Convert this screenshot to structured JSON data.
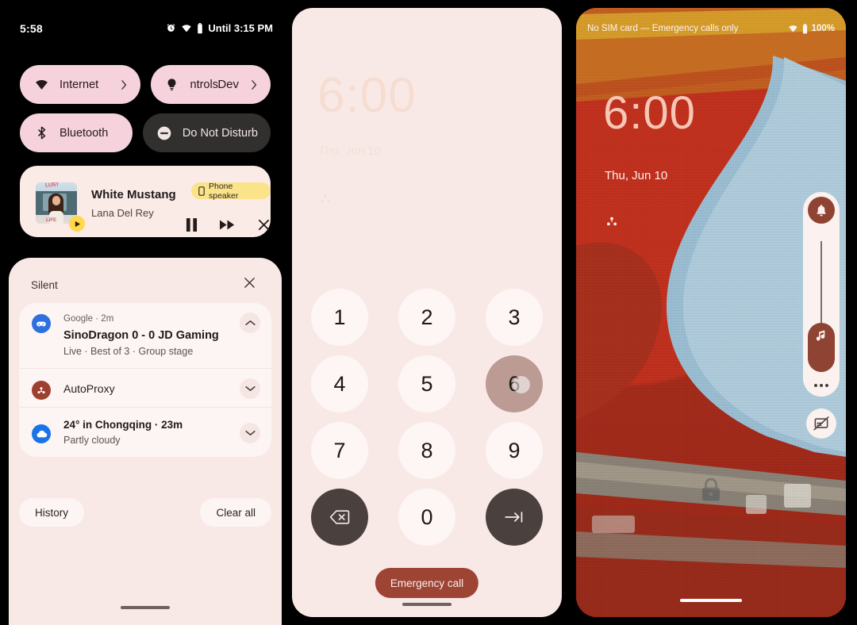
{
  "quick_settings": {
    "status_bar": {
      "time": "5:58",
      "alarm_icon": "alarm-icon",
      "wifi_icon": "wifi-icon",
      "battery_icon": "battery-icon",
      "dnd_until": "Until 3:15 PM"
    },
    "tiles": [
      {
        "label": "Internet",
        "icon": "wifi-icon",
        "state": "on",
        "has_chevron": true
      },
      {
        "label": "ntrols",
        "label_secondary": "Dev",
        "icon": "lightbulb-icon",
        "state": "on",
        "has_chevron": true
      },
      {
        "label": "Bluetooth",
        "icon": "bluetooth-icon",
        "state": "on",
        "has_chevron": false
      },
      {
        "label": "Do Not Disturb",
        "icon": "dnd-icon",
        "state": "off",
        "has_chevron": false
      }
    ],
    "media_player": {
      "title": "White Mustang",
      "artist": "Lana Del Rey",
      "output_chip": "Phone speaker",
      "output_icon": "phone-icon",
      "album_top_text": "LUST",
      "album_bottom_text": "LIFE",
      "pause_icon": "pause-icon",
      "next_icon": "fast-forward-icon",
      "close_icon": "close-icon",
      "play_badge_icon": "play-icon"
    },
    "shade": {
      "section_title": "Silent",
      "close_icon": "close-icon",
      "notifications": [
        {
          "app": "Google",
          "time": "2m",
          "meta": "Google · 2m",
          "title": "SinoDragon 0 - 0 JD Gaming",
          "subtitle": "Live · Best of 3 · Group stage",
          "icon": "gamepad-icon",
          "icon_color": "#2f6fe0",
          "expand_icon": "chevron-up-icon"
        },
        {
          "app": "AutoProxy",
          "meta": "AutoProxy",
          "icon": "autoproxy-icon",
          "icon_color": "#9e4030",
          "expand_icon": "chevron-down-icon"
        },
        {
          "app": "Weather",
          "meta": "24° in Chongqing · 23m",
          "title_line": "24° in Chongqing",
          "time": "23m",
          "subtitle": "Partly cloudy",
          "icon": "cloud-icon",
          "icon_color": "#1a73e8",
          "expand_icon": "chevron-down-icon"
        }
      ],
      "history_label": "History",
      "clear_all_label": "Clear all"
    }
  },
  "dialer": {
    "ghost_clock": "6:00",
    "ghost_date": "Thu, Jun 10",
    "ghost_icon": "autoproxy-icon",
    "keys": [
      [
        "1",
        "2",
        "3"
      ],
      [
        "4",
        "5",
        "6"
      ],
      [
        "7",
        "8",
        "9"
      ]
    ],
    "pressed_key": "6",
    "bottom_row": {
      "backspace_icon": "backspace-icon",
      "zero": "0",
      "next_icon": "tab-next-icon"
    },
    "emergency_call_label": "Emergency call"
  },
  "lock_screen": {
    "status_bar": {
      "carrier": "No SIM card — Emergency calls only",
      "wifi_icon": "wifi-icon",
      "battery_icon": "battery-icon",
      "battery_level": "100%"
    },
    "clock": "6:00",
    "date": "Thu, Jun 10",
    "notification_icon": "autoproxy-icon",
    "lock_icon": "lock-icon",
    "volume_panel": {
      "ring_icon": "bell-icon",
      "thumb_icon": "music-note-icon",
      "more_icon": "more-dots-icon",
      "level_percent": 18
    },
    "cast_off_icon": "cast-off-icon"
  },
  "colors": {
    "accent_pink": "#f6d2dc",
    "surface_pink": "#f9e9e6",
    "surface_light": "#fdf5f3",
    "dark_tile": "#32302f",
    "brand_brown": "#8e4333",
    "emergency_red": "#9d4435",
    "chip_yellow": "#fbe38a"
  }
}
